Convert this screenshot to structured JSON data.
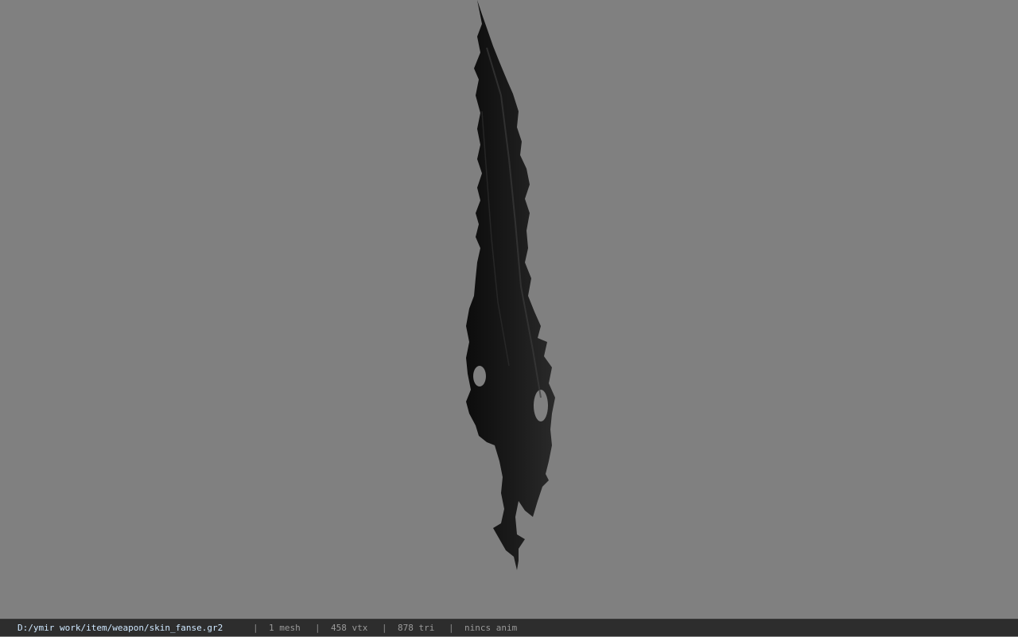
{
  "viewport": {
    "background_color": "#808080",
    "model_color": "#141414"
  },
  "statusbar": {
    "file_path": "D:/ymir work/item/weapon/skin_fanse.gr2",
    "separator": "|",
    "mesh_count": "1 mesh",
    "vertex_count": "458 vtx",
    "triangle_count": "878 tri",
    "animation": "nincs anim"
  }
}
